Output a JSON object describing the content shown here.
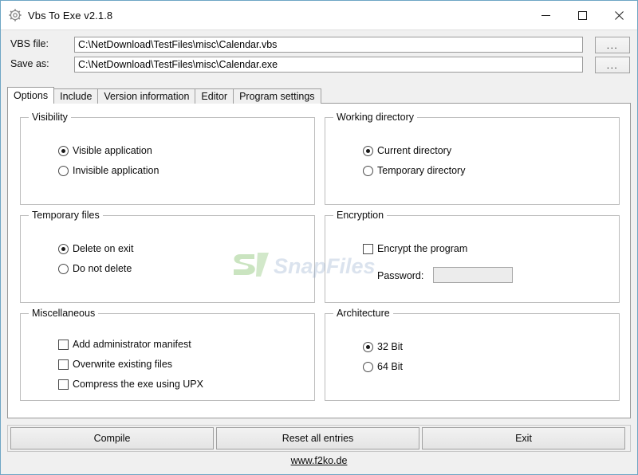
{
  "window": {
    "title": "Vbs To Exe v2.1.8",
    "icon": "gear-icon",
    "minimize_label": "Minimize",
    "maximize_label": "Maximize",
    "close_label": "Close",
    "border_color": "#6ea6c4"
  },
  "file_fields": {
    "vbs": {
      "label": "VBS file:",
      "value": "C:\\NetDownload\\TestFiles\\misc\\Calendar.vbs",
      "placeholder": "",
      "browse_label": "..."
    },
    "save_as": {
      "label": "Save as:",
      "value": "C:\\NetDownload\\TestFiles\\misc\\Calendar.exe",
      "placeholder": "",
      "browse_label": "..."
    }
  },
  "tabs": [
    {
      "label": "Options",
      "active": true
    },
    {
      "label": "Include",
      "active": false
    },
    {
      "label": "Version information",
      "active": false
    },
    {
      "label": "Editor",
      "active": false
    },
    {
      "label": "Program settings",
      "active": false
    }
  ],
  "groups": {
    "visibility": {
      "title": "Visibility",
      "options": [
        {
          "label": "Visible application",
          "selected": true
        },
        {
          "label": "Invisible application",
          "selected": false
        }
      ]
    },
    "working_directory": {
      "title": "Working directory",
      "options": [
        {
          "label": "Current directory",
          "selected": true
        },
        {
          "label": "Temporary directory",
          "selected": false
        }
      ]
    },
    "temporary_files": {
      "title": "Temporary files",
      "options": [
        {
          "label": "Delete on exit",
          "selected": true
        },
        {
          "label": "Do not delete",
          "selected": false
        }
      ]
    },
    "encryption": {
      "title": "Encryption",
      "checkbox": {
        "label": "Encrypt the program",
        "checked": false
      },
      "password_label": "Password:",
      "password_value": "",
      "password_placeholder": "",
      "password_enabled": false
    },
    "miscellaneous": {
      "title": "Miscellaneous",
      "options": [
        {
          "label": "Add administrator manifest",
          "checked": false
        },
        {
          "label": "Overwrite existing files",
          "checked": false
        },
        {
          "label": "Compress the exe using UPX",
          "checked": false
        }
      ]
    },
    "architecture": {
      "title": "Architecture",
      "options": [
        {
          "label": "32 Bit",
          "selected": true
        },
        {
          "label": "64 Bit",
          "selected": false
        }
      ]
    }
  },
  "buttons": {
    "compile": "Compile",
    "reset": "Reset all entries",
    "exit": "Exit"
  },
  "footer": {
    "link": "www.f2ko.de"
  },
  "watermark": {
    "text": "SnapFiles",
    "logo_color": "#52a832",
    "text_color": "#8aa6c8"
  }
}
